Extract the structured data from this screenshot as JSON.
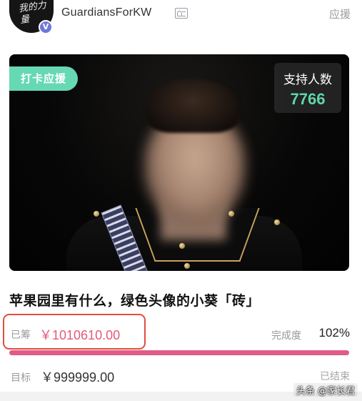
{
  "colors": {
    "accent_green": "#66d8b4",
    "supporter_number": "#5fd6a9",
    "raised_pink": "#e35a7a",
    "progress": "#e05b85",
    "highlight_border": "#e24d3f",
    "verified_badge": "#6e78d8"
  },
  "header": {
    "avatar_icon": "avatar-image",
    "avatar_text": "我的力量",
    "verified_icon": "verified-v-icon",
    "verified_glyph": "V",
    "username": "GuardiansForKW",
    "id_icon": "id-card-icon",
    "action_label": "应援"
  },
  "cover": {
    "tag_label": "打卡应援",
    "supporters_label": "支持人数",
    "supporters_count": "7766",
    "image_icon": "blurred-portrait-image"
  },
  "campaign": {
    "title": "苹果园里有什么，绿色头像的小葵「砖」",
    "raised_label": "已筹",
    "raised_value": "￥1010610.00",
    "completion_label": "完成度",
    "completion_value": "102%",
    "progress_fraction": 1.0,
    "goal_label": "目标",
    "goal_value": "￥999999.00",
    "status": "已结束"
  },
  "watermark": {
    "text": "头条 @家长君"
  }
}
